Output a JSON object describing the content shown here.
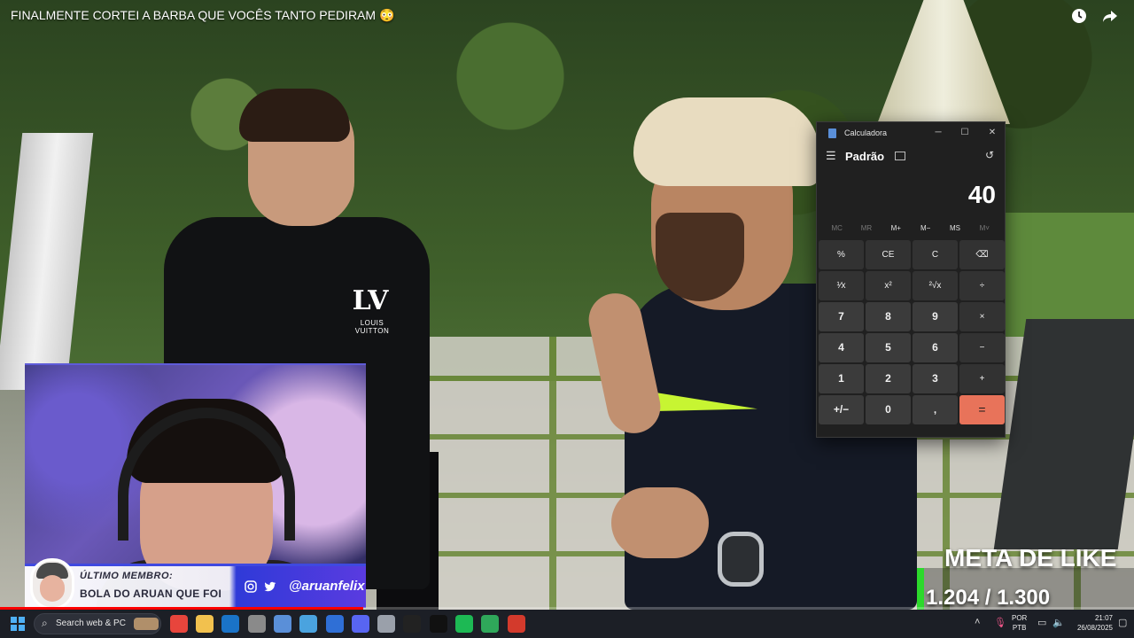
{
  "video": {
    "title": "FINALMENTE CORTEI A BARBA QUE VOCÊS TANTO PEDIRAM 😳",
    "icons": {
      "watch_later": "clock-icon",
      "share": "share-arrow-icon"
    },
    "progress_fraction": 0.32
  },
  "calculator": {
    "window_title": "Calculadora",
    "mode": "Padrão",
    "display_value": "40",
    "memory_buttons": [
      {
        "label": "MC",
        "enabled": false
      },
      {
        "label": "MR",
        "enabled": false
      },
      {
        "label": "M+",
        "enabled": true
      },
      {
        "label": "M−",
        "enabled": true
      },
      {
        "label": "MS",
        "enabled": true
      },
      {
        "label": "M˅",
        "enabled": false
      }
    ],
    "keys": [
      {
        "label": "%",
        "type": "op",
        "name": "percent"
      },
      {
        "label": "CE",
        "type": "op",
        "name": "clear-entry"
      },
      {
        "label": "C",
        "type": "op",
        "name": "clear"
      },
      {
        "label": "⌫",
        "type": "op",
        "name": "backspace"
      },
      {
        "label": "¹⁄x",
        "type": "op",
        "name": "reciprocal"
      },
      {
        "label": "x²",
        "type": "op",
        "name": "square"
      },
      {
        "label": "²√x",
        "type": "op",
        "name": "square-root"
      },
      {
        "label": "÷",
        "type": "op",
        "name": "divide"
      },
      {
        "label": "7",
        "type": "num",
        "name": "digit-7"
      },
      {
        "label": "8",
        "type": "num",
        "name": "digit-8"
      },
      {
        "label": "9",
        "type": "num",
        "name": "digit-9"
      },
      {
        "label": "×",
        "type": "op",
        "name": "multiply"
      },
      {
        "label": "4",
        "type": "num",
        "name": "digit-4"
      },
      {
        "label": "5",
        "type": "num",
        "name": "digit-5"
      },
      {
        "label": "6",
        "type": "num",
        "name": "digit-6"
      },
      {
        "label": "−",
        "type": "op",
        "name": "subtract"
      },
      {
        "label": "1",
        "type": "num",
        "name": "digit-1"
      },
      {
        "label": "2",
        "type": "num",
        "name": "digit-2"
      },
      {
        "label": "3",
        "type": "num",
        "name": "digit-3"
      },
      {
        "label": "+",
        "type": "op",
        "name": "add"
      },
      {
        "label": "+/−",
        "type": "num",
        "name": "negate"
      },
      {
        "label": "0",
        "type": "num",
        "name": "digit-0"
      },
      {
        "label": ",",
        "type": "num",
        "name": "decimal"
      },
      {
        "label": "=",
        "type": "equals",
        "name": "equals"
      }
    ],
    "accent_color": "#e8735a"
  },
  "webcam": {
    "member_label": "ÚLTIMO MEMBRO:",
    "member_name": "BOLA DO ARUAN QUE FOI",
    "social_handle": "@aruanfelix",
    "social_icons": [
      "instagram-icon",
      "twitter-icon"
    ]
  },
  "like_goal": {
    "title": "META DE LIKE",
    "count_text": "1.204 / 1.300",
    "current": 1204,
    "target": 1300,
    "bar_color": "#2cd92c"
  },
  "taskbar": {
    "search_placeholder": "Search web & PC",
    "apps": [
      {
        "name": "chrome-icon",
        "color": "#e8453c"
      },
      {
        "name": "file-explorer-icon",
        "color": "#f2c14e"
      },
      {
        "name": "outlook-icon",
        "color": "#1a73c8"
      },
      {
        "name": "obs-icon",
        "color": "#8a8a8a"
      },
      {
        "name": "calculator-icon",
        "color": "#5a8fd8"
      },
      {
        "name": "notepad-icon",
        "color": "#4aa3df"
      },
      {
        "name": "app-m-icon",
        "color": "#2f6fd6"
      },
      {
        "name": "discord-icon",
        "color": "#5865f2"
      },
      {
        "name": "camera-icon",
        "color": "#9aa0aa"
      },
      {
        "name": "capcut-icon",
        "color": "#222222"
      },
      {
        "name": "game-icon",
        "color": "#111111"
      },
      {
        "name": "spotify-icon",
        "color": "#1db954"
      },
      {
        "name": "green-app-icon",
        "color": "#2fa85a"
      },
      {
        "name": "red-app-icon",
        "color": "#d33a2c"
      }
    ],
    "language": "POR",
    "layout": "PTB",
    "time": "21:07",
    "date": "26/08/2025"
  }
}
